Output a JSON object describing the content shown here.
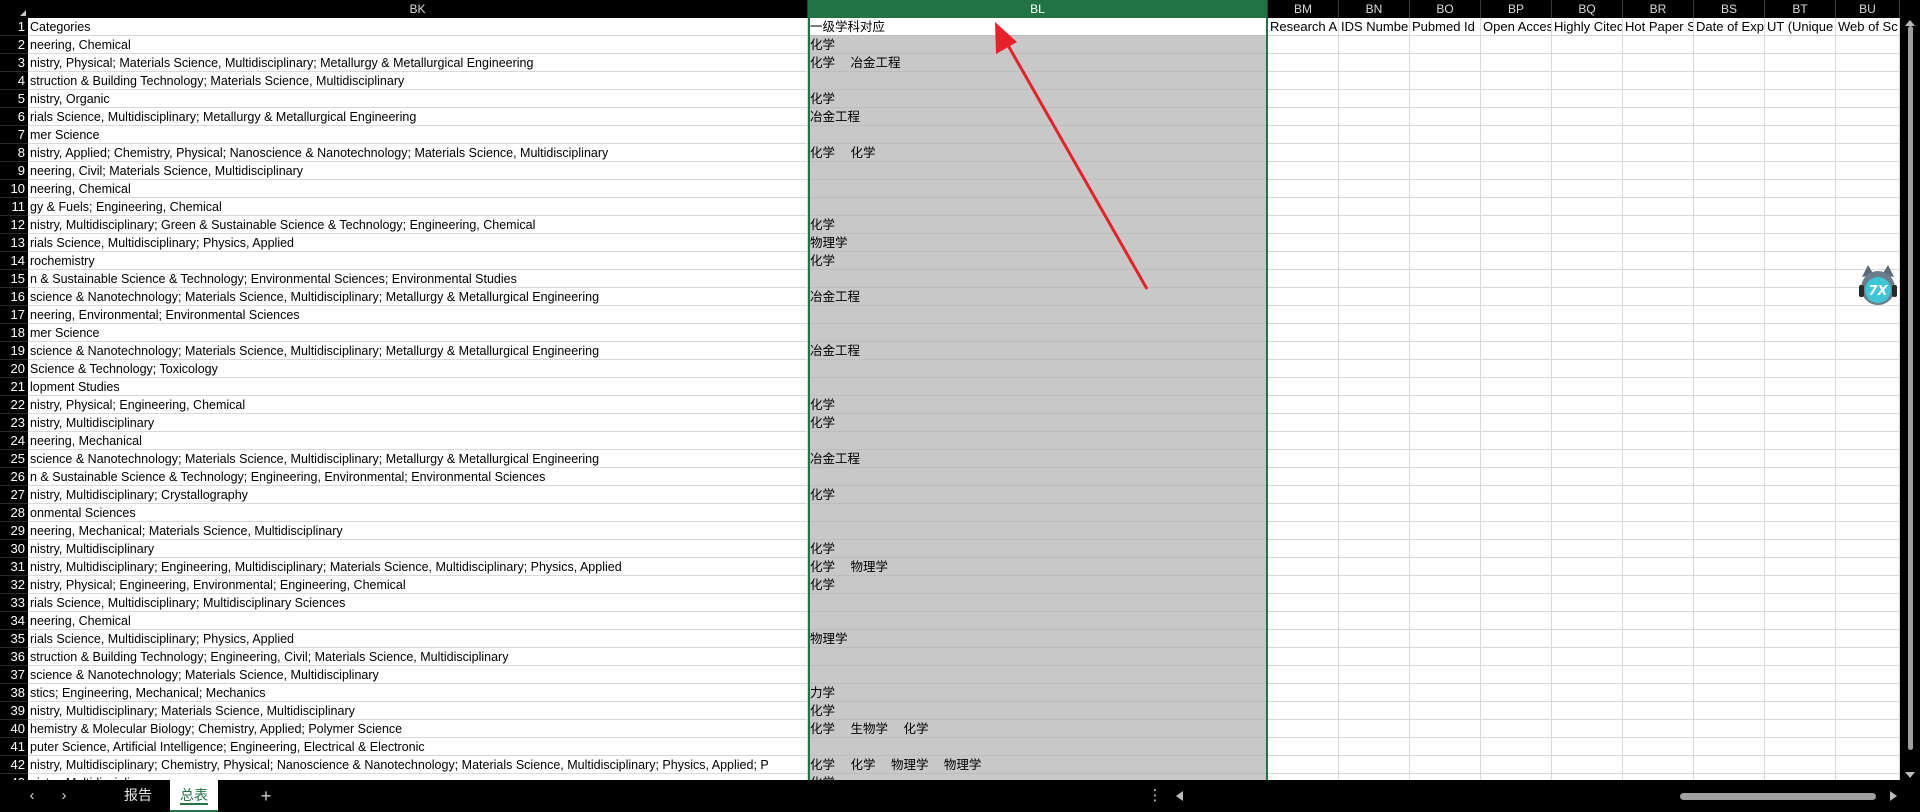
{
  "columns": [
    {
      "key": "BK",
      "label": "BK"
    },
    {
      "key": "BL",
      "label": "BL"
    },
    {
      "key": "BM",
      "label": "BM"
    },
    {
      "key": "BN",
      "label": "BN"
    },
    {
      "key": "BO",
      "label": "BO"
    },
    {
      "key": "BP",
      "label": "BP"
    },
    {
      "key": "BQ",
      "label": "BQ"
    },
    {
      "key": "BR",
      "label": "BR"
    },
    {
      "key": "BS",
      "label": "BS"
    },
    {
      "key": "BT",
      "label": "BT"
    },
    {
      "key": "BU",
      "label": "BU"
    }
  ],
  "header_row": {
    "BK": "Categories",
    "BL": "一级学科对应",
    "BM": "Research A",
    "BN": "IDS Number",
    "BO": "Pubmed Id",
    "BP": "Open Acces",
    "BQ": "Highly Cited",
    "BR": "Hot Paper S",
    "BS": "Date of Exp",
    "BT": "UT (Unique",
    "BU": "Web of Sc"
  },
  "rows": [
    {
      "n": "2",
      "bk": "neering, Chemical",
      "bl": "化学"
    },
    {
      "n": "3",
      "bk": "nistry, Physical; Materials Science, Multidisciplinary; Metallurgy & Metallurgical Engineering",
      "bl": "化学 冶金工程"
    },
    {
      "n": "4",
      "bk": "struction & Building Technology; Materials Science, Multidisciplinary",
      "bl": ""
    },
    {
      "n": "5",
      "bk": "nistry, Organic",
      "bl": "化学"
    },
    {
      "n": "6",
      "bk": "rials Science, Multidisciplinary; Metallurgy & Metallurgical Engineering",
      "bl": "冶金工程"
    },
    {
      "n": "7",
      "bk": "mer Science",
      "bl": ""
    },
    {
      "n": "8",
      "bk": "nistry, Applied; Chemistry, Physical; Nanoscience & Nanotechnology; Materials Science, Multidisciplinary",
      "bl": "化学 化学"
    },
    {
      "n": "9",
      "bk": "neering, Civil; Materials Science, Multidisciplinary",
      "bl": ""
    },
    {
      "n": "10",
      "bk": "neering, Chemical",
      "bl": ""
    },
    {
      "n": "11",
      "bk": "gy & Fuels; Engineering, Chemical",
      "bl": ""
    },
    {
      "n": "12",
      "bk": "nistry, Multidisciplinary; Green & Sustainable Science & Technology; Engineering, Chemical",
      "bl": "化学"
    },
    {
      "n": "13",
      "bk": "rials Science, Multidisciplinary; Physics, Applied",
      "bl": "物理学"
    },
    {
      "n": "14",
      "bk": "rochemistry",
      "bl": "化学"
    },
    {
      "n": "15",
      "bk": "n & Sustainable Science & Technology; Environmental Sciences; Environmental Studies",
      "bl": ""
    },
    {
      "n": "16",
      "bk": "science & Nanotechnology; Materials Science, Multidisciplinary; Metallurgy & Metallurgical Engineering",
      "bl": "冶金工程"
    },
    {
      "n": "17",
      "bk": "neering, Environmental; Environmental Sciences",
      "bl": ""
    },
    {
      "n": "18",
      "bk": "mer Science",
      "bl": ""
    },
    {
      "n": "19",
      "bk": "science & Nanotechnology; Materials Science, Multidisciplinary; Metallurgy & Metallurgical Engineering",
      "bl": "冶金工程"
    },
    {
      "n": "20",
      "bk": " Science & Technology; Toxicology",
      "bl": ""
    },
    {
      "n": "21",
      "bk": "lopment Studies",
      "bl": ""
    },
    {
      "n": "22",
      "bk": "nistry, Physical; Engineering, Chemical",
      "bl": "化学"
    },
    {
      "n": "23",
      "bk": "nistry, Multidisciplinary",
      "bl": "化学"
    },
    {
      "n": "24",
      "bk": "neering, Mechanical",
      "bl": ""
    },
    {
      "n": "25",
      "bk": "science & Nanotechnology; Materials Science, Multidisciplinary; Metallurgy & Metallurgical Engineering",
      "bl": "冶金工程"
    },
    {
      "n": "26",
      "bk": "n & Sustainable Science & Technology; Engineering, Environmental; Environmental Sciences",
      "bl": ""
    },
    {
      "n": "27",
      "bk": "nistry, Multidisciplinary; Crystallography",
      "bl": "化学"
    },
    {
      "n": "28",
      "bk": "onmental Sciences",
      "bl": ""
    },
    {
      "n": "29",
      "bk": "neering, Mechanical; Materials Science, Multidisciplinary",
      "bl": ""
    },
    {
      "n": "30",
      "bk": "nistry, Multidisciplinary",
      "bl": "化学"
    },
    {
      "n": "31",
      "bk": "nistry, Multidisciplinary; Engineering, Multidisciplinary; Materials Science, Multidisciplinary; Physics, Applied",
      "bl": "化学 物理学"
    },
    {
      "n": "32",
      "bk": "nistry, Physical; Engineering, Environmental; Engineering, Chemical",
      "bl": "化学"
    },
    {
      "n": "33",
      "bk": "rials Science, Multidisciplinary; Multidisciplinary Sciences",
      "bl": ""
    },
    {
      "n": "34",
      "bk": "neering, Chemical",
      "bl": ""
    },
    {
      "n": "35",
      "bk": "rials Science, Multidisciplinary; Physics, Applied",
      "bl": "物理学"
    },
    {
      "n": "36",
      "bk": "struction & Building Technology; Engineering, Civil; Materials Science, Multidisciplinary",
      "bl": ""
    },
    {
      "n": "37",
      "bk": "science & Nanotechnology; Materials Science, Multidisciplinary",
      "bl": ""
    },
    {
      "n": "38",
      "bk": "stics; Engineering, Mechanical; Mechanics",
      "bl": "力学"
    },
    {
      "n": "39",
      "bk": "nistry, Multidisciplinary; Materials Science, Multidisciplinary",
      "bl": "化学"
    },
    {
      "n": "40",
      "bk": "hemistry & Molecular Biology; Chemistry, Applied; Polymer Science",
      "bl": "化学 生物学 化学"
    },
    {
      "n": "41",
      "bk": "puter Science, Artificial Intelligence; Engineering, Electrical & Electronic",
      "bl": ""
    },
    {
      "n": "42",
      "bk": "nistry, Multidisciplinary; Chemistry, Physical; Nanoscience & Nanotechnology; Materials Science, Multidisciplinary; Physics, Applied; P",
      "bl": "化学 化学 物理学 物理学"
    },
    {
      "n": "43",
      "bk": "nistry, Multidisciplinary",
      "bl": "化学"
    }
  ],
  "sheet_tabs": [
    {
      "label": "报告",
      "active": false
    },
    {
      "label": "总表",
      "active": true
    }
  ],
  "tabbar": {
    "add": "+",
    "more": "⋮",
    "prev": "‹",
    "next": "›"
  },
  "colors": {
    "accent": "#217346",
    "selected_fill": "#c8c8c8",
    "arrow": "#e8202a"
  },
  "icons": {
    "avatar": "cat-avatar-icon"
  }
}
